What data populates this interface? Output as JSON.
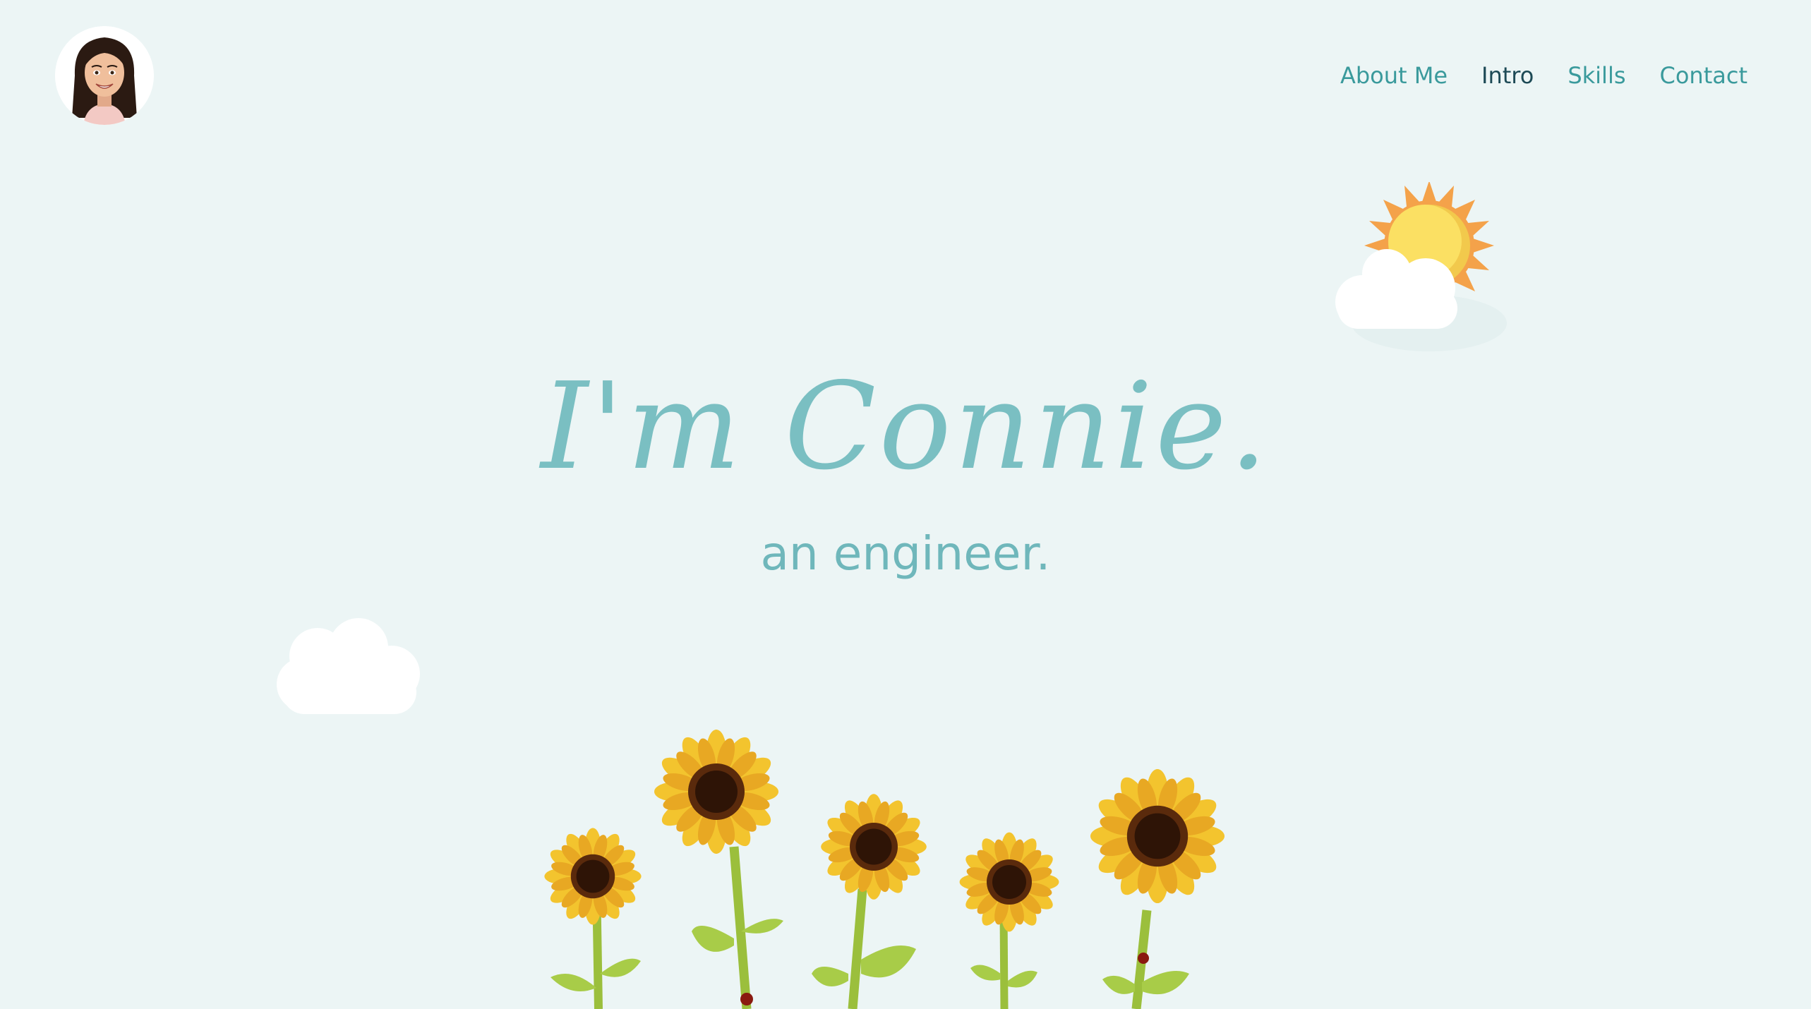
{
  "header": {
    "avatar_icon": "bitmoji-avatar-icon",
    "nav": [
      {
        "label": "About Me",
        "active": false
      },
      {
        "label": "Intro",
        "active": true
      },
      {
        "label": "Skills",
        "active": false
      },
      {
        "label": "Contact",
        "active": false
      }
    ]
  },
  "hero": {
    "title": "I'm Connie.",
    "subtitle": "an engineer."
  },
  "decor": {
    "sun_icon": "sun-with-cloud-icon",
    "cloud_icon": "cloud-icon",
    "flowers_icon": "sunflowers-illustration"
  },
  "colors": {
    "background": "#ecf5f5",
    "nav_link": "#3a9a9c",
    "nav_active": "#1d4a56",
    "title": "#7abfc2",
    "subtitle": "#6fb7bb"
  }
}
